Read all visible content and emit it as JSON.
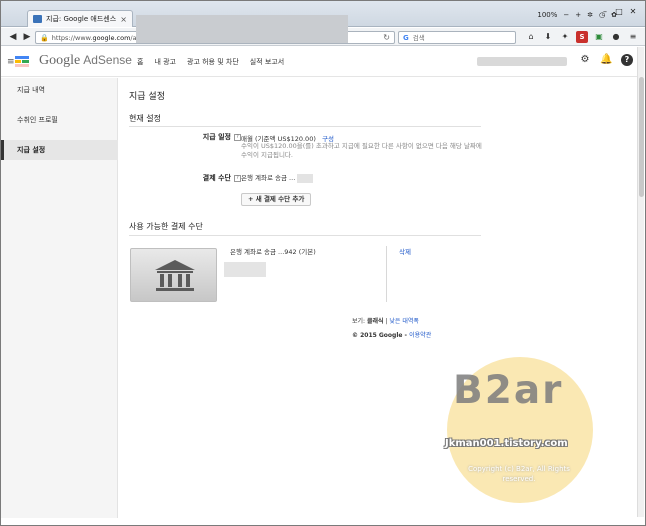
{
  "browser": {
    "tab_title": "지급: Google 애드센스",
    "tab_close": "×",
    "new_tab": "+",
    "zoom": "100%",
    "zoom_minus": "−",
    "zoom_plus": "+",
    "url_prefix": "https://www.",
    "url_host": "google.com",
    "url_suffix": "/adsen",
    "search_placeholder": "검색",
    "search_engine_label": "G"
  },
  "adsense_header": {
    "logo_google": "Google",
    "logo_product": "AdSense",
    "menu": [
      "홈",
      "내 광고",
      "광고 허용 및 차단",
      "실적 보고서"
    ]
  },
  "sidebar": {
    "items": [
      {
        "label": "지급 내역"
      },
      {
        "label": "수취인 프로필"
      },
      {
        "label": "지급 설정"
      }
    ]
  },
  "main": {
    "page_title": "지급 설정",
    "current_settings": {
      "title": "현재 설정",
      "schedule_label": "지급 일정",
      "schedule_value": "매월 (기준액 US$120.00)",
      "schedule_link": "구성",
      "schedule_desc": "수익이 US$120.00을(를) 초과하고 지급에 필요한 다른 사항이 없으면 다음 해당 날짜에 수익이 지급됩니다.",
      "method_label": "결제 수단",
      "method_value": "은행 계좌로 송금 ...",
      "add_button": "+ 새 결제 수단 추가"
    },
    "available_methods": {
      "title": "사용 가능한 결제 수단",
      "method_line": "은행 계좌로 송금 ...942 (기본)",
      "delete_link": "삭제"
    },
    "footer": {
      "view_prefix": "보기: ",
      "view_classic": "클래식",
      "separator": " | ",
      "view_old": "낮은 대역폭",
      "copyright": "© 2015 Google - ",
      "terms": "이용약관"
    }
  },
  "watermark": {
    "big": "B2ar",
    "sub": "Jkman001.tistory.com",
    "copy": "Copyright (c) B2ar, All Rights reserved."
  },
  "colors": {
    "link": "#1a55c8",
    "watermark_circle": "#f6d574",
    "sidebar_bg": "#f5f5f5"
  }
}
